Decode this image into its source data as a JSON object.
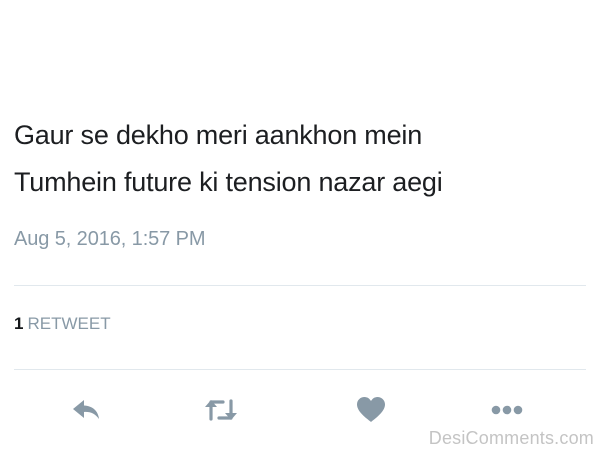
{
  "tweet": {
    "lines": [
      "Gaur se dekho meri aankhon mein",
      "Tumhein future ki tension nazar aegi"
    ],
    "timestamp": "Aug 5, 2016, 1:57 PM"
  },
  "stats": {
    "retweet_count": "1",
    "retweet_label": "RETWEET"
  },
  "actions": [
    {
      "name": "reply",
      "icon": "reply-icon"
    },
    {
      "name": "retweet",
      "icon": "retweet-icon"
    },
    {
      "name": "like",
      "icon": "heart-icon"
    },
    {
      "name": "more",
      "icon": "more-dots-icon"
    }
  ],
  "colors": {
    "text": "#1c1e21",
    "muted": "#8899a6",
    "icon": "#8899a6",
    "divider": "#e1e8ed",
    "watermark": "#c4c4c4"
  },
  "watermark": "DesiComments.com"
}
